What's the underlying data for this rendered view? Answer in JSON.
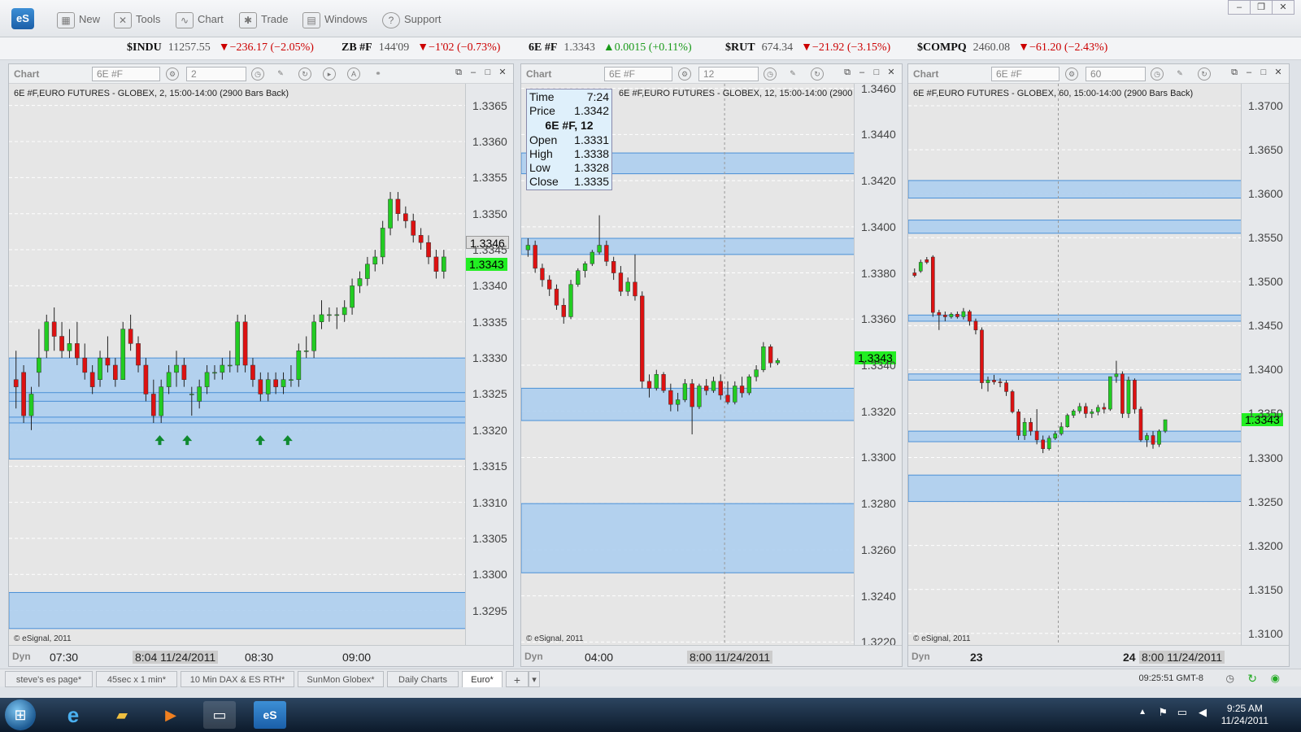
{
  "app": {
    "logo": "eS"
  },
  "toolbar": {
    "items": [
      {
        "label": "New",
        "icon": "new-chart-icon"
      },
      {
        "label": "Tools",
        "icon": "tools-icon"
      },
      {
        "label": "Chart",
        "icon": "chart-icon"
      },
      {
        "label": "Trade",
        "icon": "trade-icon"
      },
      {
        "label": "Windows",
        "icon": "windows-icon"
      },
      {
        "label": "Support",
        "icon": "support-icon"
      }
    ]
  },
  "ticker": [
    {
      "symbol": "$INDU",
      "price": "11257.55",
      "change": "▼−236.17 (−2.05%)",
      "dir": "down"
    },
    {
      "symbol": "ZB #F",
      "price": "144'09",
      "change": "▼−1'02 (−0.73%)",
      "dir": "down"
    },
    {
      "symbol": "6E #F",
      "price": "1.3343",
      "change": "▲0.0015 (+0.11%)",
      "dir": "up"
    },
    {
      "symbol": "$RUT",
      "price": "674.34",
      "change": "▼−21.92 (−3.15%)",
      "dir": "down"
    },
    {
      "symbol": "$COMPQ",
      "price": "2460.08",
      "change": "▼−61.20 (−2.43%)",
      "dir": "down"
    }
  ],
  "colors": {
    "zone": "#a9cdee",
    "zone_border": "#4a90d6",
    "up_candle": "#22cc22",
    "down_candle": "#dd1111",
    "last_price": "#22ee22"
  },
  "panels": [
    {
      "header": {
        "title": "Chart",
        "symbol": "6E #F",
        "interval": "2"
      },
      "plot_title": "6E #F,EURO FUTURES - GLOBEX, 2, 15:00-14:00 (2900 Bars Back)",
      "copyright": "© eSignal, 2011",
      "dyn": "Dyn",
      "x_labels": [
        "07:30",
        "8:04 11/24/2011",
        "08:30",
        "09:00"
      ],
      "crosshair_price": "1.3346",
      "last_price": "1.3343"
    },
    {
      "header": {
        "title": "Chart",
        "symbol": "6E #F",
        "interval": "12"
      },
      "plot_title": "6E #F,EURO FUTURES - GLOBEX, 12, 15:00-14:00 (2900 Bars Back)",
      "copyright": "© eSignal, 2011",
      "dyn": "Dyn",
      "x_labels": [
        "04:00",
        "8:00 11/24/2011"
      ],
      "last_price": "1.3343",
      "tooltip": {
        "time_label": "Time",
        "time": "7:24",
        "price_label": "Price",
        "price": "1.3342",
        "header": "6E #F, 12",
        "open_label": "Open",
        "open": "1.3331",
        "high_label": "High",
        "high": "1.3338",
        "low_label": "Low",
        "low": "1.3328",
        "close_label": "Close",
        "close": "1.3335"
      }
    },
    {
      "header": {
        "title": "Chart",
        "symbol": "6E #F",
        "interval": "60"
      },
      "plot_title": "6E #F,EURO FUTURES - GLOBEX, 60, 15:00-14:00 (2900 Bars Back)",
      "copyright": "© eSignal, 2011",
      "dyn": "Dyn",
      "x_labels": [
        "23",
        "24",
        "8:00 11/24/2011"
      ],
      "last_price": "1.3343"
    }
  ],
  "chart_data": [
    {
      "type": "candlestick",
      "title": "6E #F,EURO FUTURES - GLOBEX, 2, 15:00-14:00 (2900 Bars Back)",
      "ylim": [
        1.329,
        1.3368
      ],
      "yticks": [
        1.3365,
        1.336,
        1.3355,
        1.335,
        1.3345,
        1.334,
        1.3335,
        1.333,
        1.3325,
        1.332,
        1.3315,
        1.331,
        1.3305,
        1.33,
        1.3295
      ],
      "zones": [
        [
          1.3316,
          1.333
        ],
        [
          1.32925,
          1.32975
        ],
        [
          1.3321,
          1.33218
        ],
        [
          1.3324,
          1.33252
        ]
      ],
      "arrows": [
        0.33,
        0.39,
        0.55,
        0.61
      ],
      "candles": [
        [
          1.3327,
          1.3331,
          1.3323,
          1.3326
        ],
        [
          1.3328,
          1.3329,
          1.3321,
          1.3322
        ],
        [
          1.3322,
          1.3326,
          1.332,
          1.3325
        ],
        [
          1.3328,
          1.3334,
          1.3326,
          1.333
        ],
        [
          1.3331,
          1.3336,
          1.333,
          1.3335
        ],
        [
          1.3335,
          1.3337,
          1.3331,
          1.3333
        ],
        [
          1.3333,
          1.3335,
          1.333,
          1.3331
        ],
        [
          1.3331,
          1.3334,
          1.333,
          1.3332
        ],
        [
          1.3332,
          1.3335,
          1.3329,
          1.333
        ],
        [
          1.333,
          1.3332,
          1.3327,
          1.3328
        ],
        [
          1.3328,
          1.3329,
          1.3325,
          1.3326
        ],
        [
          1.3327,
          1.3331,
          1.3326,
          1.333
        ],
        [
          1.333,
          1.3333,
          1.3328,
          1.3329
        ],
        [
          1.3329,
          1.333,
          1.3326,
          1.3327
        ],
        [
          1.3327,
          1.3335,
          1.3327,
          1.3334
        ],
        [
          1.3334,
          1.3336,
          1.3331,
          1.3332
        ],
        [
          1.3332,
          1.3333,
          1.3328,
          1.3329
        ],
        [
          1.3329,
          1.333,
          1.3324,
          1.3325
        ],
        [
          1.3325,
          1.3327,
          1.3321,
          1.3322
        ],
        [
          1.3322,
          1.3327,
          1.3321,
          1.3326
        ],
        [
          1.3326,
          1.3329,
          1.3325,
          1.3328
        ],
        [
          1.3328,
          1.3331,
          1.3326,
          1.3329
        ],
        [
          1.3329,
          1.333,
          1.3326,
          1.3327
        ],
        [
          1.3325,
          1.3326,
          1.3322,
          1.3325
        ],
        [
          1.3324,
          1.3327,
          1.3323,
          1.3326
        ],
        [
          1.3326,
          1.3329,
          1.3325,
          1.3328
        ],
        [
          1.3328,
          1.3329,
          1.3327,
          1.3328
        ],
        [
          1.3328,
          1.333,
          1.3327,
          1.3329
        ],
        [
          1.3329,
          1.3331,
          1.3328,
          1.3329
        ],
        [
          1.3329,
          1.3336,
          1.3328,
          1.3335
        ],
        [
          1.3335,
          1.3336,
          1.3328,
          1.3329
        ],
        [
          1.3329,
          1.333,
          1.3326,
          1.3327
        ],
        [
          1.3327,
          1.3328,
          1.3324,
          1.3325
        ],
        [
          1.3325,
          1.3328,
          1.3324,
          1.3327
        ],
        [
          1.3327,
          1.3328,
          1.3325,
          1.3326
        ],
        [
          1.3326,
          1.3328,
          1.3325,
          1.3327
        ],
        [
          1.3327,
          1.3329,
          1.3326,
          1.3327
        ],
        [
          1.3327,
          1.3332,
          1.3326,
          1.3331
        ],
        [
          1.3331,
          1.3333,
          1.333,
          1.3331
        ],
        [
          1.3331,
          1.3336,
          1.333,
          1.3335
        ],
        [
          1.3335,
          1.3338,
          1.3334,
          1.3336
        ],
        [
          1.3336,
          1.3337,
          1.3335,
          1.3336
        ],
        [
          1.3336,
          1.3337,
          1.3334,
          1.3336
        ],
        [
          1.3336,
          1.3338,
          1.3335,
          1.3337
        ],
        [
          1.3337,
          1.3341,
          1.3336,
          1.334
        ],
        [
          1.334,
          1.3342,
          1.3339,
          1.3341
        ],
        [
          1.3341,
          1.3344,
          1.334,
          1.3343
        ],
        [
          1.3343,
          1.3345,
          1.3342,
          1.3344
        ],
        [
          1.3344,
          1.3349,
          1.3343,
          1.3348
        ],
        [
          1.3348,
          1.3353,
          1.3347,
          1.3352
        ],
        [
          1.3352,
          1.3353,
          1.3349,
          1.335
        ],
        [
          1.335,
          1.3351,
          1.3348,
          1.3349
        ],
        [
          1.3349,
          1.335,
          1.3346,
          1.3347
        ],
        [
          1.3347,
          1.3348,
          1.3345,
          1.3346
        ],
        [
          1.3346,
          1.3347,
          1.3343,
          1.3344
        ],
        [
          1.3344,
          1.3345,
          1.3341,
          1.3342
        ],
        [
          1.3342,
          1.3345,
          1.3341,
          1.3344
        ]
      ]
    },
    {
      "type": "candlestick",
      "title": "6E #F,EURO FUTURES - GLOBEX, 12, 15:00-14:00 (2900 Bars Back)",
      "ylim": [
        1.3218,
        1.3462
      ],
      "yticks": [
        1.346,
        1.344,
        1.342,
        1.34,
        1.338,
        1.336,
        1.334,
        1.332,
        1.33,
        1.328,
        1.326,
        1.324,
        1.322
      ],
      "zones": [
        [
          1.3423,
          1.3432
        ],
        [
          1.3388,
          1.3395
        ],
        [
          1.3316,
          1.333
        ],
        [
          1.325,
          1.328
        ]
      ],
      "candles": [
        [
          1.339,
          1.3395,
          1.3387,
          1.3392
        ],
        [
          1.3392,
          1.3394,
          1.338,
          1.3382
        ],
        [
          1.3382,
          1.3384,
          1.3374,
          1.3377
        ],
        [
          1.3377,
          1.3379,
          1.337,
          1.3373
        ],
        [
          1.3373,
          1.3375,
          1.3364,
          1.3366
        ],
        [
          1.3366,
          1.3369,
          1.3358,
          1.3361
        ],
        [
          1.3361,
          1.3377,
          1.336,
          1.3375
        ],
        [
          1.3375,
          1.3382,
          1.3374,
          1.3381
        ],
        [
          1.3381,
          1.3385,
          1.3378,
          1.3384
        ],
        [
          1.3384,
          1.339,
          1.3383,
          1.3389
        ],
        [
          1.3389,
          1.3405,
          1.3388,
          1.3392
        ],
        [
          1.3392,
          1.3394,
          1.3383,
          1.3385
        ],
        [
          1.3385,
          1.3387,
          1.3377,
          1.338
        ],
        [
          1.338,
          1.3383,
          1.337,
          1.3372
        ],
        [
          1.3372,
          1.3378,
          1.337,
          1.3376
        ],
        [
          1.3376,
          1.3388,
          1.3368,
          1.337
        ],
        [
          1.337,
          1.3372,
          1.333,
          1.3333
        ],
        [
          1.3333,
          1.3336,
          1.3326,
          1.333
        ],
        [
          1.333,
          1.3338,
          1.3329,
          1.3336
        ],
        [
          1.3336,
          1.3337,
          1.3328,
          1.3329
        ],
        [
          1.3329,
          1.3332,
          1.332,
          1.3323
        ],
        [
          1.3323,
          1.3328,
          1.332,
          1.3325
        ],
        [
          1.3325,
          1.3334,
          1.3324,
          1.3332
        ],
        [
          1.3332,
          1.3334,
          1.331,
          1.3322
        ],
        [
          1.3322,
          1.3332,
          1.3321,
          1.3331
        ],
        [
          1.3331,
          1.3334,
          1.3327,
          1.3329
        ],
        [
          1.3329,
          1.3335,
          1.3328,
          1.3333
        ],
        [
          1.3333,
          1.3336,
          1.3325,
          1.3327
        ],
        [
          1.3327,
          1.3333,
          1.3323,
          1.3324
        ],
        [
          1.3324,
          1.3333,
          1.3323,
          1.3331
        ],
        [
          1.3331,
          1.3335,
          1.3326,
          1.3328
        ],
        [
          1.3328,
          1.3336,
          1.3327,
          1.3335
        ],
        [
          1.3335,
          1.334,
          1.3333,
          1.3338
        ],
        [
          1.3338,
          1.335,
          1.3337,
          1.3348
        ],
        [
          1.3348,
          1.3349,
          1.3339,
          1.3341
        ],
        [
          1.3341,
          1.3343,
          1.334,
          1.3342
        ]
      ]
    },
    {
      "type": "candlestick",
      "title": "6E #F,EURO FUTURES - GLOBEX, 60, 15:00-14:00 (2900 Bars Back)",
      "ylim": [
        1.3085,
        1.3725
      ],
      "yticks": [
        1.37,
        1.365,
        1.36,
        1.355,
        1.35,
        1.345,
        1.34,
        1.335,
        1.33,
        1.325,
        1.32,
        1.315,
        1.31
      ],
      "zones": [
        [
          1.3595,
          1.3615
        ],
        [
          1.3555,
          1.357
        ],
        [
          1.3455,
          1.3462
        ],
        [
          1.3388,
          1.3395
        ],
        [
          1.3318,
          1.333
        ],
        [
          1.325,
          1.328
        ]
      ],
      "candles": [
        [
          1.351,
          1.3515,
          1.3505,
          1.3507
        ],
        [
          1.3512,
          1.3525,
          1.351,
          1.3522
        ],
        [
          1.3525,
          1.3528,
          1.352,
          1.3522
        ],
        [
          1.3528,
          1.353,
          1.346,
          1.3465
        ],
        [
          1.3465,
          1.3468,
          1.3445,
          1.3462
        ],
        [
          1.3462,
          1.3466,
          1.3455,
          1.346
        ],
        [
          1.346,
          1.3465,
          1.3458,
          1.3463
        ],
        [
          1.3463,
          1.3466,
          1.3458,
          1.346
        ],
        [
          1.346,
          1.347,
          1.3457,
          1.3466
        ],
        [
          1.3466,
          1.3468,
          1.345,
          1.3455
        ],
        [
          1.3455,
          1.3458,
          1.344,
          1.3445
        ],
        [
          1.3445,
          1.3448,
          1.3378,
          1.3385
        ],
        [
          1.3385,
          1.3392,
          1.3375,
          1.3388
        ],
        [
          1.3388,
          1.3394,
          1.3383,
          1.3386
        ],
        [
          1.3386,
          1.339,
          1.338,
          1.3385
        ],
        [
          1.3385,
          1.3388,
          1.337,
          1.3375
        ],
        [
          1.3375,
          1.3377,
          1.335,
          1.3352
        ],
        [
          1.3352,
          1.3355,
          1.332,
          1.3325
        ],
        [
          1.3325,
          1.3345,
          1.332,
          1.334
        ],
        [
          1.334,
          1.3345,
          1.3325,
          1.333
        ],
        [
          1.333,
          1.3355,
          1.3315,
          1.332
        ],
        [
          1.332,
          1.3325,
          1.3305,
          1.331
        ],
        [
          1.331,
          1.3325,
          1.3308,
          1.3322
        ],
        [
          1.3322,
          1.333,
          1.332,
          1.3327
        ],
        [
          1.3327,
          1.334,
          1.3325,
          1.3335
        ],
        [
          1.3335,
          1.335,
          1.3334,
          1.3348
        ],
        [
          1.3348,
          1.3355,
          1.3345,
          1.3353
        ],
        [
          1.3353,
          1.3362,
          1.335,
          1.3358
        ],
        [
          1.3358,
          1.3362,
          1.3345,
          1.335
        ],
        [
          1.335,
          1.3355,
          1.3345,
          1.3352
        ],
        [
          1.3352,
          1.336,
          1.3348,
          1.3357
        ],
        [
          1.3357,
          1.3362,
          1.335,
          1.3355
        ],
        [
          1.3355,
          1.3375,
          1.3353,
          1.3392
        ],
        [
          1.3392,
          1.341,
          1.3385,
          1.3395
        ],
        [
          1.3395,
          1.3398,
          1.3345,
          1.335
        ],
        [
          1.335,
          1.3392,
          1.3345,
          1.3388
        ],
        [
          1.3388,
          1.339,
          1.335,
          1.3355
        ],
        [
          1.3355,
          1.3358,
          1.3318,
          1.332
        ],
        [
          1.332,
          1.3328,
          1.3312,
          1.3325
        ],
        [
          1.3325,
          1.333,
          1.331,
          1.3315
        ],
        [
          1.3315,
          1.3332,
          1.3312,
          1.333
        ],
        [
          1.333,
          1.334,
          1.3328,
          1.3343
        ]
      ]
    }
  ],
  "tabs": [
    {
      "label": "steve's es page*",
      "active": false
    },
    {
      "label": "45sec x 1 min*",
      "active": false
    },
    {
      "label": "10 Min DAX & ES RTH*",
      "active": false
    },
    {
      "label": "SunMon Globex*",
      "active": false
    },
    {
      "label": "Daily Charts",
      "active": false
    },
    {
      "label": "Euro*",
      "active": true
    }
  ],
  "status": {
    "clock": "09:25:51 GMT-8"
  },
  "taskbar": {
    "time": "9:25 AM",
    "date": "11/24/2011"
  }
}
